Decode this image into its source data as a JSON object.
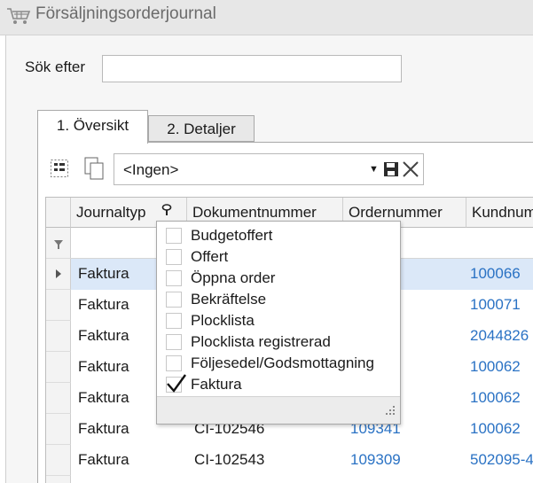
{
  "window": {
    "title": "Försäljningsorderjournal",
    "icon": "shopping-cart-icon"
  },
  "search": {
    "label": "Sök efter",
    "value": "",
    "placeholder": ""
  },
  "tabs": [
    {
      "label": "1. Översikt",
      "active": true
    },
    {
      "label": "2. Detaljer",
      "active": false
    }
  ],
  "toolbar": {
    "view_select_value": "<Ingen>",
    "icons": [
      "field-chooser-icon",
      "copy-icon",
      "save-icon",
      "delete-icon",
      "dropdown-arrow-icon"
    ]
  },
  "grid": {
    "columns": [
      "Journaltyp",
      "Dokumentnummer",
      "Ordernummer",
      "Kundnum"
    ],
    "rows": [
      {
        "journaltyp": "Faktura",
        "dokumentnummer": "",
        "ordernummer": "",
        "kundnummer": "100066",
        "selected": true
      },
      {
        "journaltyp": "Faktura",
        "dokumentnummer": "",
        "ordernummer": "",
        "kundnummer": "100071"
      },
      {
        "journaltyp": "Faktura",
        "dokumentnummer": "",
        "ordernummer": "",
        "kundnummer": "2044826"
      },
      {
        "journaltyp": "Faktura",
        "dokumentnummer": "",
        "ordernummer": "",
        "kundnummer": "100062"
      },
      {
        "journaltyp": "Faktura",
        "dokumentnummer": "",
        "ordernummer": "",
        "kundnummer": "100062"
      },
      {
        "journaltyp": "Faktura",
        "dokumentnummer": "CI-102546",
        "ordernummer": "109341",
        "kundnummer": "100062"
      },
      {
        "journaltyp": "Faktura",
        "dokumentnummer": "CI-102543",
        "ordernummer": "109309",
        "kundnummer": "502095-4"
      }
    ]
  },
  "filter_dropdown": {
    "items": [
      {
        "label": "Budgetoffert",
        "checked": false
      },
      {
        "label": "Offert",
        "checked": false
      },
      {
        "label": "Öppna order",
        "checked": false
      },
      {
        "label": "Bekräftelse",
        "checked": false
      },
      {
        "label": "Plocklista",
        "checked": false
      },
      {
        "label": "Plocklista registrerad",
        "checked": false
      },
      {
        "label": "Följesedel/Godsmottagning",
        "checked": false
      },
      {
        "label": "Faktura",
        "checked": true
      }
    ]
  },
  "colors": {
    "link": "#2a72c4",
    "selected_row": "#dbe8f8",
    "titlebar": "#e7e7e7"
  }
}
